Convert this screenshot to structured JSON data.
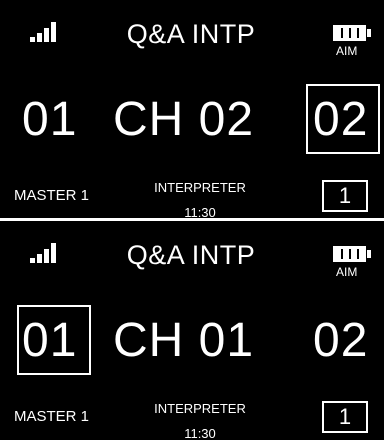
{
  "screens": [
    {
      "title": "Q&A INTP",
      "battery_label": "AIM",
      "channel_left": "01",
      "channel_mid": "CH 02",
      "channel_right": "02",
      "selected": "right",
      "master_label": "MASTER 1",
      "interpreter_label": "INTERPRETER",
      "time": "11:30",
      "box_value": "1"
    },
    {
      "title": "Q&A INTP",
      "battery_label": "AIM",
      "channel_left": "01",
      "channel_mid": "CH 01",
      "channel_right": "02",
      "selected": "left",
      "master_label": "MASTER 1",
      "interpreter_label": "INTERPRETER",
      "time": "11:30",
      "box_value": "1"
    }
  ],
  "icons": {
    "signal": "signal-strength-icon",
    "battery": "battery-icon"
  },
  "colors": {
    "background": "#000000",
    "foreground": "#ffffff"
  }
}
